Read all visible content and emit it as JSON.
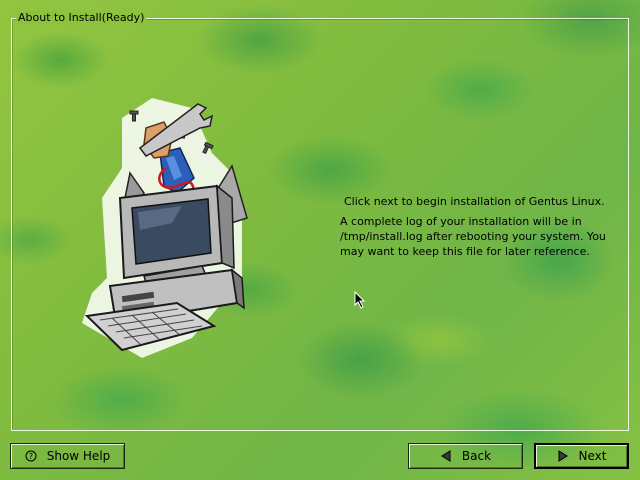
{
  "frame": {
    "title": "About to Install(Ready)"
  },
  "message": {
    "line1": "Click next to begin installation of Gentus Linux.",
    "line2": "A complete log of your installation will be in /tmp/install.log after rebooting your system. You may want to keep this file for later reference."
  },
  "buttons": {
    "help_label": "Show Help",
    "back_label": "Back",
    "next_label": "Next"
  },
  "icons": {
    "help": "question-icon",
    "back": "left-triangle-icon",
    "next": "right-triangle-icon",
    "illustration": "computer-with-wrench-illustration",
    "cursor": "mouse-pointer-icon"
  },
  "colors": {
    "background": "#8cc23c",
    "frame_border": "#eef5e0",
    "text": "#000000"
  }
}
